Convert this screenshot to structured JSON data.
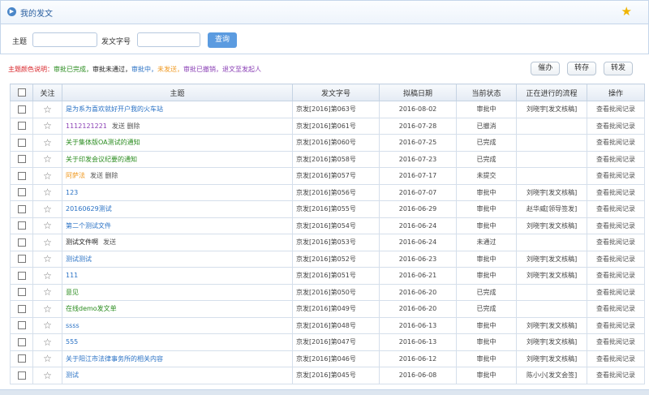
{
  "header": {
    "title": "我的发文"
  },
  "search": {
    "subject_label": "主题",
    "subject_value": "",
    "docno_label": "发文字号",
    "docno_value": "",
    "query_label": "查询"
  },
  "legend": {
    "prefix": "主题颜色说明：",
    "approved": "审批已完成，",
    "rejected": "审批未通过，",
    "approving": "审批中，",
    "pending": "未发送，",
    "revoked": "审批已撤销，",
    "returned": "退文至发起人"
  },
  "actions": {
    "urge": "催办",
    "forward": "转存",
    "resend": "转发"
  },
  "columns": [
    "关注",
    "主题",
    "发文字号",
    "拟稿日期",
    "当前状态",
    "正在进行的流程",
    "操作"
  ],
  "rows": [
    {
      "subject": "是为系为喜欢就好开户我的火车站",
      "state": "approving",
      "extra": "",
      "docno": "京发[2016]第063号",
      "date": "2016-08-02",
      "status": "审批中",
      "flow": "刘晓宇[发文核稿]",
      "op": "查看批阅记录"
    },
    {
      "subject": "1112121221",
      "state": "revoked",
      "extra": "发送 删除",
      "docno": "京发[2016]第061号",
      "date": "2016-07-28",
      "status": "已撤消",
      "flow": "",
      "op": "查看批阅记录"
    },
    {
      "subject": "关于集体版OA测试的通知",
      "state": "approved",
      "extra": "",
      "docno": "京发[2016]第060号",
      "date": "2016-07-25",
      "status": "已完成",
      "flow": "",
      "op": "查看批阅记录"
    },
    {
      "subject": "关于印发会议纪要的通知",
      "state": "approved",
      "extra": "",
      "docno": "京发[2016]第058号",
      "date": "2016-07-23",
      "status": "已完成",
      "flow": "",
      "op": "查看批阅记录"
    },
    {
      "subject": "阿萨法",
      "state": "pending",
      "extra": "发送 删除",
      "docno": "京发[2016]第057号",
      "date": "2016-07-17",
      "status": "未提交",
      "flow": "",
      "op": "查看批阅记录"
    },
    {
      "subject": "123",
      "state": "approving",
      "extra": "",
      "docno": "京发[2016]第056号",
      "date": "2016-07-07",
      "status": "审批中",
      "flow": "刘晓宇[发文核稿]",
      "op": "查看批阅记录"
    },
    {
      "subject": "20160629测试",
      "state": "approving",
      "extra": "",
      "docno": "京发[2016]第055号",
      "date": "2016-06-29",
      "status": "审批中",
      "flow": "赵华威[领导签发]",
      "op": "查看批阅记录"
    },
    {
      "subject": "第二个测试文件",
      "state": "approving",
      "extra": "",
      "docno": "京发[2016]第054号",
      "date": "2016-06-24",
      "status": "审批中",
      "flow": "刘晓宇[发文核稿]",
      "op": "查看批阅记录"
    },
    {
      "subject": "测试文件啊",
      "state": "rejected",
      "extra": "发送",
      "docno": "京发[2016]第053号",
      "date": "2016-06-24",
      "status": "未通过",
      "flow": "",
      "op": "查看批阅记录"
    },
    {
      "subject": "测试测试",
      "state": "approving",
      "extra": "",
      "docno": "京发[2016]第052号",
      "date": "2016-06-23",
      "status": "审批中",
      "flow": "刘晓宇[发文核稿]",
      "op": "查看批阅记录"
    },
    {
      "subject": "111",
      "state": "approving",
      "extra": "",
      "docno": "京发[2016]第051号",
      "date": "2016-06-21",
      "status": "审批中",
      "flow": "刘晓宇[发文核稿]",
      "op": "查看批阅记录"
    },
    {
      "subject": "意见",
      "state": "approved",
      "extra": "",
      "docno": "京发[2016]第050号",
      "date": "2016-06-20",
      "status": "已完成",
      "flow": "",
      "op": "查看批阅记录"
    },
    {
      "subject": "在线demo发文单",
      "state": "approved",
      "extra": "",
      "docno": "京发[2016]第049号",
      "date": "2016-06-20",
      "status": "已完成",
      "flow": "",
      "op": "查看批阅记录"
    },
    {
      "subject": "ssss",
      "state": "approving",
      "extra": "",
      "docno": "京发[2016]第048号",
      "date": "2016-06-13",
      "status": "审批中",
      "flow": "刘晓宇[发文核稿]",
      "op": "查看批阅记录"
    },
    {
      "subject": "555",
      "state": "approving",
      "extra": "",
      "docno": "京发[2016]第047号",
      "date": "2016-06-13",
      "status": "审批中",
      "flow": "刘晓宇[发文核稿]",
      "op": "查看批阅记录"
    },
    {
      "subject": "关于阳江市法律事务所的相关内容",
      "state": "approving",
      "extra": "",
      "docno": "京发[2016]第046号",
      "date": "2016-06-12",
      "status": "审批中",
      "flow": "刘晓宇[发文核稿]",
      "op": "查看批阅记录"
    },
    {
      "subject": "测试",
      "state": "approving",
      "extra": "",
      "docno": "京发[2016]第045号",
      "date": "2016-06-08",
      "status": "审批中",
      "flow": "陈小小[发文会签]",
      "op": "查看批阅记录"
    }
  ]
}
